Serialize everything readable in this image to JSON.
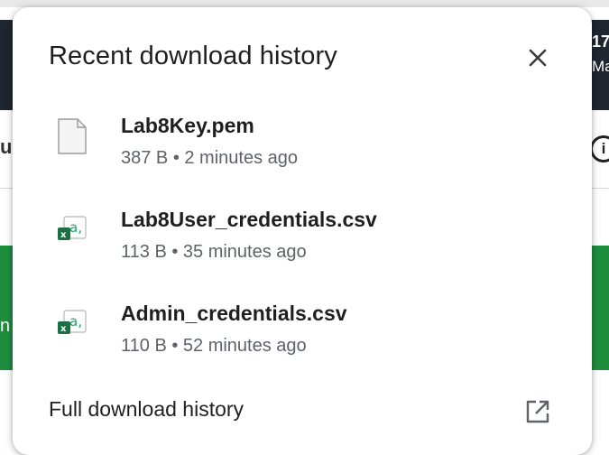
{
  "popup": {
    "title": "Recent download history",
    "close_icon": "close-icon"
  },
  "downloads": [
    {
      "name": "Lab8Key.pem",
      "size": "387 B",
      "time": "2 minutes ago",
      "meta": "387 B • 2 minutes ago",
      "icon": "generic-file-icon"
    },
    {
      "name": "Lab8User_credentials.csv",
      "size": "113 B",
      "time": "35 minutes ago",
      "meta": "113 B • 35 minutes ago",
      "icon": "excel-csv-file-icon"
    },
    {
      "name": "Admin_credentials.csv",
      "size": "110 B",
      "time": "52 minutes ago",
      "meta": "110 B • 52 minutes ago",
      "icon": "excel-csv-file-icon"
    }
  ],
  "footer": {
    "full_history_label": "Full download history",
    "open_icon": "open-in-new-icon"
  },
  "background": {
    "right_top_text": "17",
    "right_second_text": "Ma",
    "left_char": "u",
    "left_green_char": "n",
    "info_glyph": "i"
  },
  "colors": {
    "excel_green": "#1d7044",
    "csv_accent": "#21a366",
    "text_primary": "#1f1f1f",
    "text_secondary": "#5f6368",
    "background_green": "#1e8e3e"
  }
}
